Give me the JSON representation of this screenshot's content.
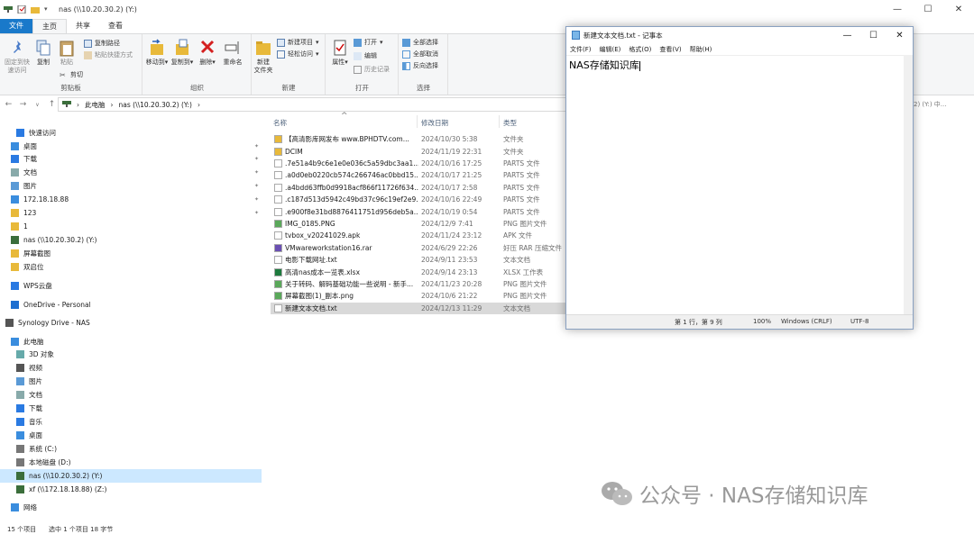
{
  "window": {
    "title": "nas (\\\\10.20.30.2) (Y:)",
    "min": "—",
    "max": "☐",
    "close": "✕"
  },
  "tabs": [
    "文件",
    "主页",
    "共享",
    "查看"
  ],
  "ribbon": {
    "clipboard": {
      "label": "剪贴板",
      "pin": "固定到快\n速访问",
      "copy": "复制",
      "paste": "粘贴",
      "copy_path": "复制路径",
      "paste_shortcut": "粘贴快捷方式",
      "cut": "剪切"
    },
    "organize": {
      "label": "组织",
      "move_to": "移动到",
      "copy_to": "复制到",
      "delete": "删除",
      "rename": "重命名"
    },
    "new": {
      "label": "新建",
      "new_folder": "新建\n文件夹",
      "new_item": "新建项目",
      "easy_access": "轻松访问"
    },
    "open": {
      "label": "打开",
      "properties": "属性",
      "open": "打开",
      "edit": "编辑",
      "history": "历史记录"
    },
    "select": {
      "label": "选择",
      "select_all": "全部选择",
      "select_none": "全部取消",
      "invert": "反向选择"
    }
  },
  "address": {
    "path": [
      "此电脑",
      "nas (\\\\10.20.30.2) (Y:)"
    ],
    "search_hint": "2) (Y:) 中..."
  },
  "sidebar": [
    {
      "label": "快速访问",
      "icon": "star-icon"
    },
    {
      "label": "桌面",
      "icon": "desktop-icon",
      "pin": true
    },
    {
      "label": "下载",
      "icon": "download-icon",
      "pin": true
    },
    {
      "label": "文档",
      "icon": "document-icon",
      "pin": true
    },
    {
      "label": "图片",
      "icon": "picture-icon",
      "pin": true
    },
    {
      "label": "172.18.18.88",
      "icon": "monitor-icon",
      "pin": true
    },
    {
      "label": "123",
      "icon": "folder-icon",
      "pin": true
    },
    {
      "label": "1",
      "icon": "folder-icon"
    },
    {
      "label": "nas (\\\\10.20.30.2) (Y:)",
      "icon": "network-drive-icon"
    },
    {
      "label": "屏幕截图",
      "icon": "folder-icon"
    },
    {
      "label": "双启位",
      "icon": "folder-icon"
    },
    {
      "label": "WPS云盘",
      "icon": "cloud-icon"
    },
    {
      "label": "OneDrive - Personal",
      "icon": "onedrive-icon"
    },
    {
      "label": "Synology Drive - NAS",
      "icon": "synology-icon"
    },
    {
      "label": "此电脑",
      "icon": "computer-icon"
    },
    {
      "label": "3D 对象",
      "icon": "cube-icon"
    },
    {
      "label": "视频",
      "icon": "video-icon"
    },
    {
      "label": "图片",
      "icon": "picture-icon"
    },
    {
      "label": "文档",
      "icon": "document-icon"
    },
    {
      "label": "下载",
      "icon": "download-icon"
    },
    {
      "label": "音乐",
      "icon": "music-icon"
    },
    {
      "label": "桌面",
      "icon": "desktop-icon"
    },
    {
      "label": "系统 (C:)",
      "icon": "drive-icon"
    },
    {
      "label": "本地磁盘 (D:)",
      "icon": "drive-icon"
    },
    {
      "label": "nas (\\\\10.20.30.2) (Y:)",
      "icon": "network-drive-icon",
      "selected": true
    },
    {
      "label": "xf (\\\\172.18.18.88) (Z:)",
      "icon": "network-drive-icon"
    },
    {
      "label": "网络",
      "icon": "network-icon"
    }
  ],
  "columns": {
    "name": "名称",
    "date": "修改日期",
    "type": "类型"
  },
  "files": [
    {
      "name": "【高清影库网发布 www.BPHDTV.com...",
      "date": "2024/10/30 5:38",
      "type": "文件夹",
      "icon": "folder-icon"
    },
    {
      "name": "DCIM",
      "date": "2024/11/19 22:31",
      "type": "文件夹",
      "icon": "folder-icon"
    },
    {
      "name": ".7e51a4b9c6e1e0e036c5a59dbc3aa1...",
      "date": "2024/10/16 17:25",
      "type": "PARTS 文件",
      "icon": "file-icon"
    },
    {
      "name": ".a0d0eb0220cb574c266746ac0bbd15...",
      "date": "2024/10/17 21:25",
      "type": "PARTS 文件",
      "icon": "file-icon"
    },
    {
      "name": ".a4bdd63ffb0d9918acf866f11726f634...",
      "date": "2024/10/17 2:58",
      "type": "PARTS 文件",
      "icon": "file-icon"
    },
    {
      "name": ".c187d513d5942c49bd37c96c19ef2e9...",
      "date": "2024/10/16 22:49",
      "type": "PARTS 文件",
      "icon": "file-icon"
    },
    {
      "name": ".e900f8e31bd8876411751d956deb5a...",
      "date": "2024/10/19 0:54",
      "type": "PARTS 文件",
      "icon": "file-icon"
    },
    {
      "name": "IMG_0185.PNG",
      "date": "2024/12/9 7:41",
      "type": "PNG 图片文件",
      "icon": "image-icon"
    },
    {
      "name": "tvbox_v20241029.apk",
      "date": "2024/11/24 23:12",
      "type": "APK 文件",
      "icon": "file-icon"
    },
    {
      "name": "VMwareworkstation16.rar",
      "date": "2024/6/29 22:26",
      "type": "好压 RAR 压缩文件",
      "icon": "archive-icon"
    },
    {
      "name": "电影下载网址.txt",
      "date": "2024/9/11 23:53",
      "type": "文本文档",
      "icon": "text-file-icon"
    },
    {
      "name": "高清nas成本一览表.xlsx",
      "date": "2024/9/14 23:13",
      "type": "XLSX 工作表",
      "icon": "excel-icon"
    },
    {
      "name": "关于转码、解码基础功能一些说明 - 新手...",
      "date": "2024/11/23 20:28",
      "type": "PNG 图片文件",
      "icon": "image-icon"
    },
    {
      "name": "屏幕截图(1)_副本.png",
      "date": "2024/10/6 21:22",
      "type": "PNG 图片文件",
      "icon": "image-icon"
    },
    {
      "name": "新建文本文档.txt",
      "date": "2024/12/13 11:29",
      "type": "文本文档",
      "icon": "text-file-icon",
      "selected": true
    }
  ],
  "notepad": {
    "title": "新建文本文档.txt - 记事本",
    "menu": [
      "文件(F)",
      "编辑(E)",
      "格式(O)",
      "查看(V)",
      "帮助(H)"
    ],
    "content": "NAS存储知识库",
    "status": {
      "position": "第 1 行，第 9 列",
      "zoom": "100%",
      "eol": "Windows (CRLF)",
      "encoding": "UTF-8"
    }
  },
  "statusbar": {
    "count": "15 个项目",
    "selected": "选中 1 个项目 18 字节"
  },
  "watermark": "公众号 · NAS存储知识库"
}
